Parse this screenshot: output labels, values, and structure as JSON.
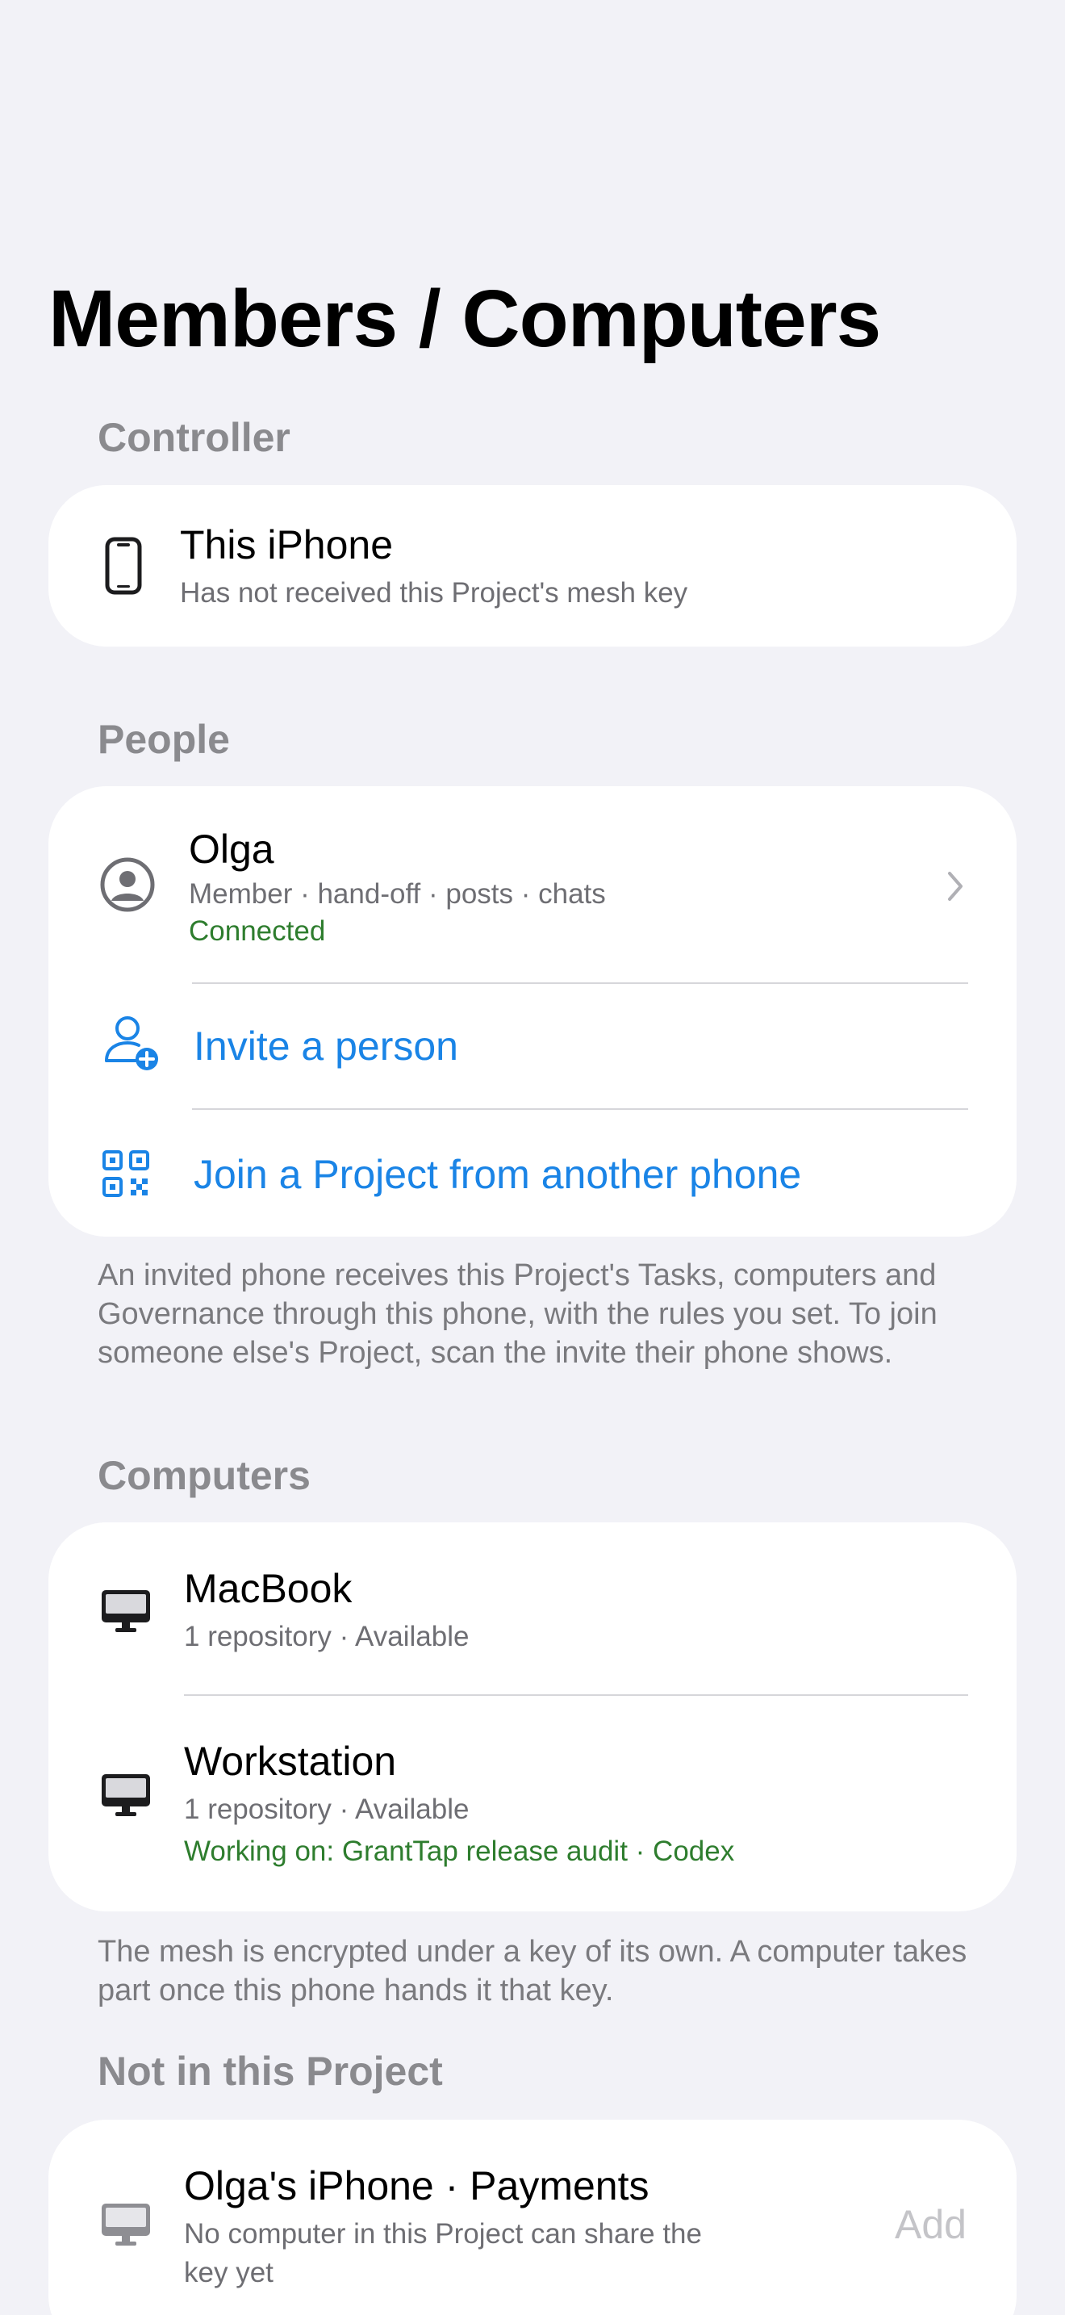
{
  "title": "Members / Computers",
  "sections": {
    "controller": {
      "header": "Controller",
      "device": {
        "name": "This iPhone",
        "status": "Has not received this Project's mesh key",
        "icon": "iphone-icon"
      }
    },
    "people": {
      "header": "People",
      "members": [
        {
          "name": "Olga",
          "roles": "Member · hand-off · posts · chats",
          "status": "Connected",
          "icon": "person-circle-icon"
        }
      ],
      "invite_label": "Invite a person",
      "join_label": "Join a Project from another phone",
      "footer": "An invited phone receives this Project's Tasks, computers and Governance through this phone, with the rules you set. To join someone else's Project, scan the invite their phone shows."
    },
    "computers": {
      "header": "Computers",
      "items": [
        {
          "name": "MacBook",
          "detail": "1 repository · Available",
          "icon": "desktop-computer-icon"
        },
        {
          "name": "Workstation",
          "detail": "1 repository · Available",
          "working": "Working on: GrantTap release audit · Codex",
          "icon": "desktop-computer-icon"
        }
      ],
      "footer": "The mesh is encrypted under a key of its own. A computer takes part once this phone hands it that key."
    },
    "not_in_project": {
      "header": "Not in this Project",
      "items": [
        {
          "name": "Olga's iPhone · Payments",
          "detail_line1": "No computer in this Project can share the",
          "detail_line2": "key yet",
          "action": "Add",
          "icon": "desktop-computer-icon"
        }
      ]
    }
  },
  "colors": {
    "background": "#f2f2f7",
    "card": "#ffffff",
    "accent": "#1a84e6",
    "success": "#2e7d2e",
    "secondary_text": "#6e6e73",
    "section_header": "#8a8a8e"
  }
}
